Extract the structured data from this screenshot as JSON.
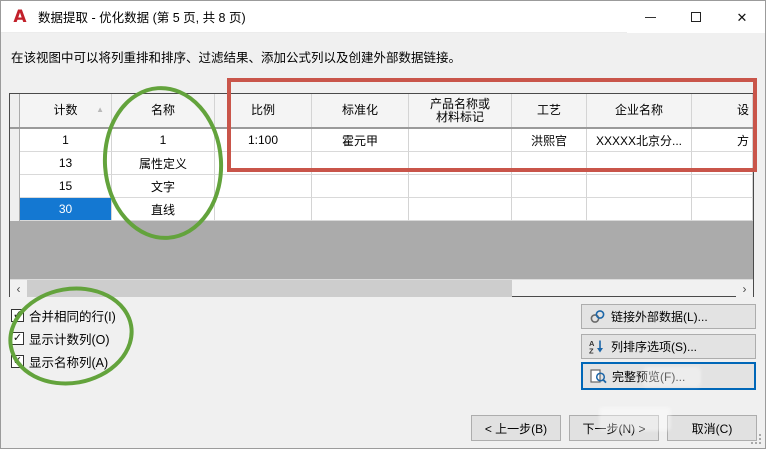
{
  "window": {
    "title": "数据提取 - 优化数据 (第 5 页, 共 8 页)",
    "app_icon": "A",
    "controls": {
      "minimize": "最小化",
      "maximize": "最大化",
      "close": "关闭"
    }
  },
  "instruction": "在该视图中可以将列重排和排序、过滤结果、添加公式列以及创建外部数据链接。",
  "table": {
    "columns": [
      {
        "label": "计数",
        "sort": "asc"
      },
      {
        "label": "名称"
      },
      {
        "label": "比例"
      },
      {
        "label": "标准化"
      },
      {
        "label": "产品名称或\n材料标记"
      },
      {
        "label": "工艺"
      },
      {
        "label": "企业名称"
      },
      {
        "label": "设",
        "clipped": true
      }
    ],
    "rows": [
      [
        "1",
        "1",
        "1:100",
        "霍元甲",
        "",
        "洪熙官",
        "XXXXX北京分...",
        "方"
      ],
      [
        "13",
        "属性定义",
        "",
        "",
        "",
        "",
        "",
        ""
      ],
      [
        "15",
        "文字",
        "",
        "",
        "",
        "",
        "",
        ""
      ],
      [
        "30",
        "直线",
        "",
        "",
        "",
        "",
        "",
        ""
      ]
    ],
    "selected_cell": {
      "row": 3,
      "col": 0
    },
    "sort_indicator": "▲"
  },
  "checkboxes": [
    {
      "label": "合并相同的行(I)",
      "checked": true
    },
    {
      "label": "显示计数列(O)",
      "checked": true
    },
    {
      "label": "显示名称列(A)",
      "checked": true
    }
  ],
  "side_buttons": [
    {
      "label": "链接外部数据(L)...",
      "icon": "link-icon",
      "focused": false
    },
    {
      "label": "列排序选项(S)...",
      "icon": "sort-az-icon",
      "focused": false
    },
    {
      "label": "完整预览(F)...",
      "icon": "preview-icon",
      "focused": true
    }
  ],
  "nav_buttons": [
    {
      "label": "< 上一步(B)"
    },
    {
      "label": "下一步(N) >"
    },
    {
      "label": "取消(C)"
    }
  ],
  "colors": {
    "selection_blue": "#1478d2",
    "annotation_green": "#63a33c",
    "annotation_red": "#c9554a",
    "logo_red": "#c2202a"
  }
}
